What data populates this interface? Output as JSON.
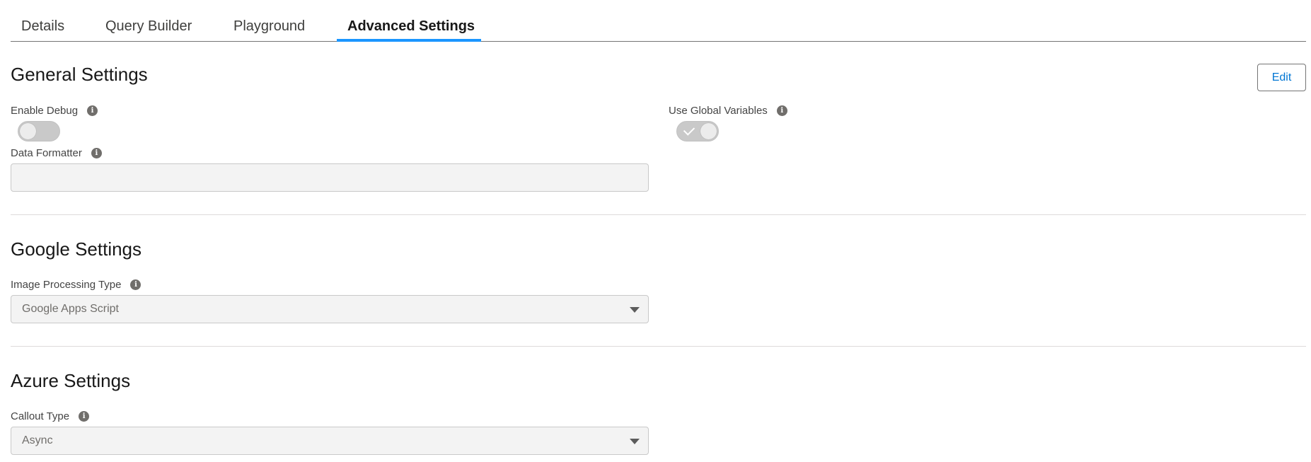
{
  "tabs": [
    {
      "label": "Details"
    },
    {
      "label": "Query Builder"
    },
    {
      "label": "Playground"
    },
    {
      "label": "Advanced Settings"
    }
  ],
  "general": {
    "title": "General Settings",
    "edit_label": "Edit",
    "enable_debug": {
      "label": "Enable Debug",
      "checked": false
    },
    "use_global_variables": {
      "label": "Use Global Variables",
      "checked": true
    },
    "data_formatter": {
      "label": "Data Formatter",
      "value": ""
    }
  },
  "google": {
    "title": "Google Settings",
    "image_processing_type": {
      "label": "Image Processing Type",
      "value": "Google Apps Script"
    }
  },
  "azure": {
    "title": "Azure Settings",
    "callout_type": {
      "label": "Callout Type",
      "value": "Async"
    }
  },
  "colors": {
    "accent": "#1b96ff",
    "link": "#0176d3"
  },
  "icons": {
    "info": "info-icon",
    "caret": "chevron-down-icon",
    "check": "check-icon"
  }
}
